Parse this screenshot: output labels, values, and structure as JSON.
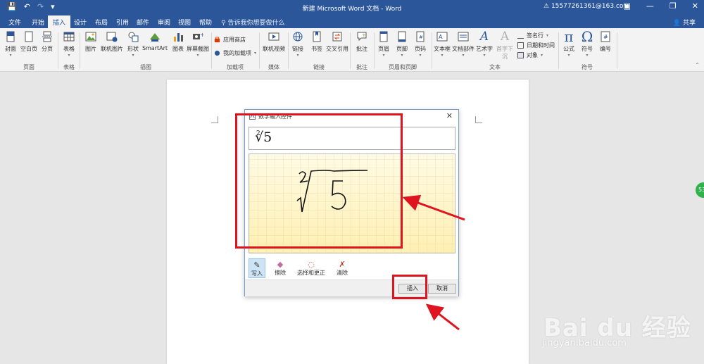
{
  "titlebar": {
    "title": "新建 Microsoft Word 文档 - Word",
    "account": "15577261361@163.com",
    "undo_icon": "undo-icon",
    "save_icon": "save-icon"
  },
  "tabs": [
    "文件",
    "开始",
    "插入",
    "设计",
    "布局",
    "引用",
    "邮件",
    "审阅",
    "视图",
    "帮助"
  ],
  "active_tab": "插入",
  "tell_me": "告诉我你想要做什么",
  "share": "共享",
  "ribbon": {
    "pages": {
      "cover": "封面",
      "blank": "空白页",
      "break": "分页",
      "label": "页面"
    },
    "tables": {
      "table": "表格",
      "label": "表格"
    },
    "illustrations": {
      "picture": "图片",
      "online": "联机图片",
      "shapes": "形状",
      "smartart": "SmartArt",
      "chart": "图表",
      "screenshot": "屏幕截图",
      "label": "插图"
    },
    "addins": {
      "store": "应用商店",
      "my": "我的加载项",
      "label": "加载项"
    },
    "media": {
      "video": "联机视频",
      "label": "媒体"
    },
    "links": {
      "link": "链接",
      "bookmark": "书签",
      "crossref": "交叉引用",
      "label": "链接"
    },
    "comments": {
      "comment": "批注",
      "label": "批注"
    },
    "header_footer": {
      "header": "页眉",
      "footer": "页脚",
      "page_number": "页码",
      "label": "页眉和页脚"
    },
    "text": {
      "textbox": "文本框",
      "quickparts": "文档部件",
      "wordart": "艺术字",
      "dropcap": "首字下沉",
      "signature": "签名行",
      "datetime": "日期和时间",
      "object": "对象",
      "label": "文本"
    },
    "symbols": {
      "equation": "公式",
      "symbol": "符号",
      "number": "编号",
      "label": "符号"
    }
  },
  "dialog": {
    "title": "数学输入控件",
    "preview_index": "2",
    "preview_expr": "√5",
    "tools": [
      {
        "label": "写入",
        "icon": "pen-icon"
      },
      {
        "label": "擦除",
        "icon": "eraser-icon"
      },
      {
        "label": "选择和更正",
        "icon": "lasso-icon"
      },
      {
        "label": "清除",
        "icon": "clear-icon"
      }
    ],
    "insert_label": "插入",
    "cancel_label": "取消"
  },
  "side_badge": "53",
  "watermark": {
    "logo": "Bai du 经验",
    "url": "jingyan.baidu.com"
  },
  "colors": {
    "brand": "#2b579a",
    "annotation": "#e0141e",
    "canvas": "#fff9d6"
  }
}
